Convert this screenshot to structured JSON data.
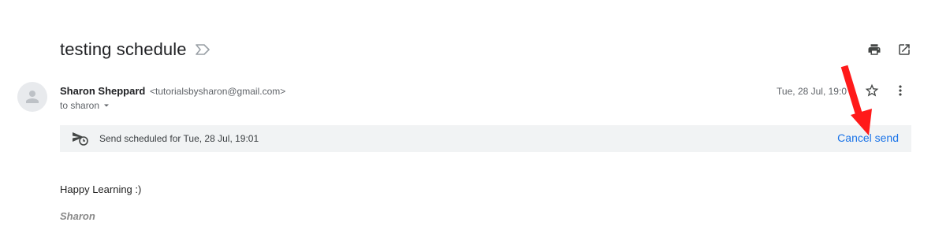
{
  "email": {
    "subject": "testing schedule",
    "sender_name": "Sharon Sheppard",
    "sender_email": "<tutorialsbysharon@gmail.com>",
    "recipient": "to sharon",
    "date": "Tue, 28 Jul, 19:0",
    "schedule_text": "Send scheduled for Tue, 28 Jul, 19:01",
    "cancel_label": "Cancel send",
    "body": "Happy Learning :)",
    "signature": "Sharon"
  },
  "icons": [
    "label-important-icon",
    "print-icon",
    "open-in-new-window-icon",
    "avatar-person-icon",
    "caret-down-icon",
    "star-icon",
    "more-vert-icon",
    "scheduled-send-icon"
  ],
  "colors": {
    "link": "#1a73e8",
    "bar": "#f1f3f4",
    "arrow": "#ff0000"
  }
}
